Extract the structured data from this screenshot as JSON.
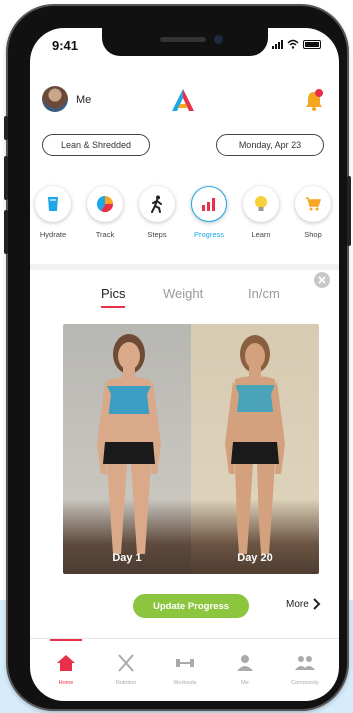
{
  "status": {
    "time": "9:41"
  },
  "header": {
    "user_label": "Me",
    "notification_count": ""
  },
  "plan_pill": "Lean & Shredded",
  "date_pill": "Monday, Apr 23",
  "quick_actions": [
    {
      "label": "Hydrate",
      "icon": "water-glass-icon"
    },
    {
      "label": "Track",
      "icon": "pie-chart-icon"
    },
    {
      "label": "Steps",
      "icon": "walking-person-icon"
    },
    {
      "label": "Progress",
      "icon": "bar-chart-icon",
      "active": true
    },
    {
      "label": "Learn",
      "icon": "lightbulb-icon"
    },
    {
      "label": "Shop",
      "icon": "shopping-cart-icon"
    }
  ],
  "progress_tabs": {
    "pics": "Pics",
    "weight": "Weight",
    "measure": "In/cm",
    "active": "Pics"
  },
  "photos": {
    "left_caption": "Day 1",
    "right_caption": "Day 20"
  },
  "update_button": "Update Progress",
  "more_link": "More",
  "tabbar": [
    {
      "label": "Home",
      "icon": "home-icon",
      "active": true
    },
    {
      "label": "Nutrition",
      "icon": "utensils-icon"
    },
    {
      "label": "Workouts",
      "icon": "dumbbell-icon"
    },
    {
      "label": "Me",
      "icon": "person-icon"
    },
    {
      "label": "Community",
      "icon": "people-icon"
    }
  ],
  "colors": {
    "accent": "#e8304a",
    "blue": "#1fa6e6",
    "green": "#8cc63f"
  }
}
